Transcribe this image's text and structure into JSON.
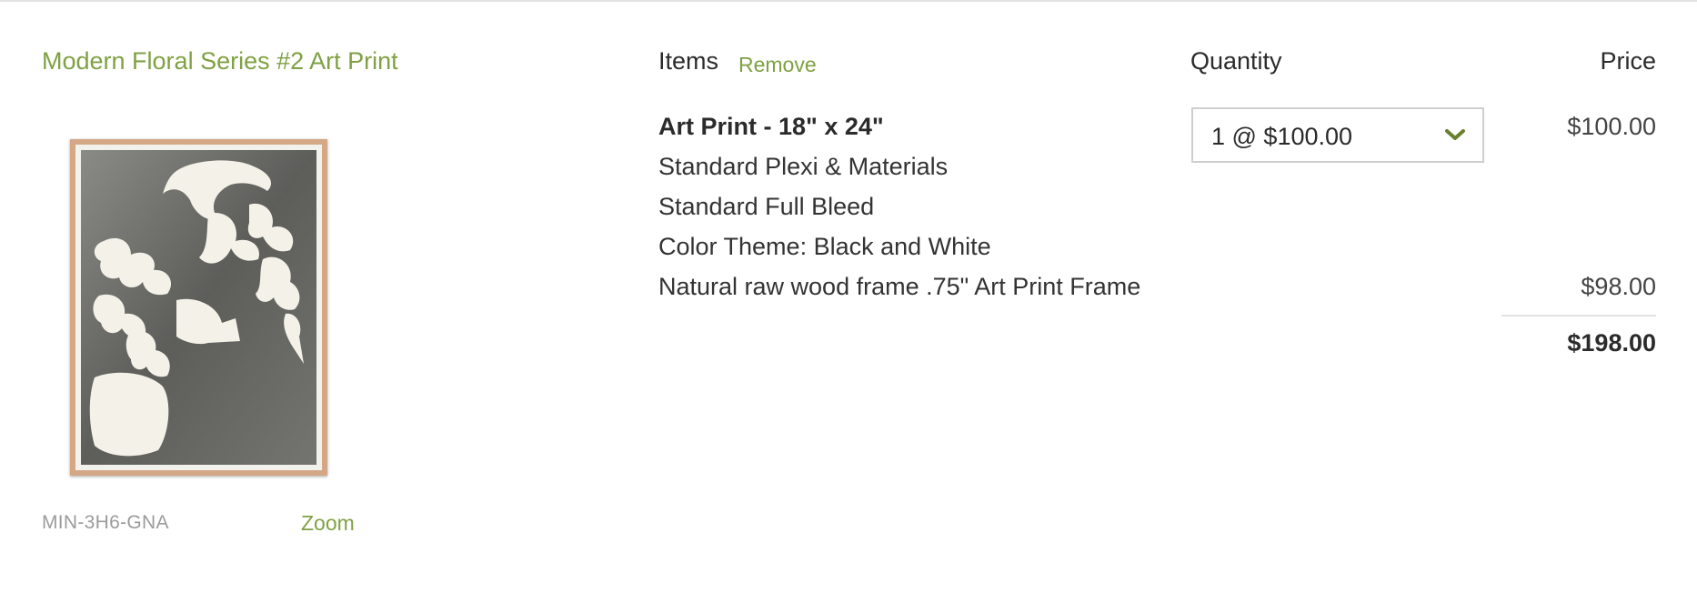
{
  "product": {
    "title": "Modern Floral Series #2 Art Print",
    "sku": "MIN-3H6-GNA",
    "zoom_label": "Zoom",
    "frame_color": "#d4a887"
  },
  "columns": {
    "items": "Items",
    "remove": "Remove",
    "quantity": "Quantity",
    "price": "Price"
  },
  "item": {
    "lines": [
      "Art Print - 18\" x 24\"",
      "Standard Plexi & Materials",
      "Standard Full Bleed",
      "Color Theme: Black and White",
      "Natural raw wood frame .75\" Art Print Frame"
    ]
  },
  "quantity": {
    "selected": "1 @ $100.00",
    "icon": "chevron-down-icon"
  },
  "prices": {
    "print": "$100.00",
    "frame": "$98.00",
    "total": "$198.00"
  },
  "colors": {
    "accent": "#7fa143",
    "text": "#2b2b2b",
    "muted": "#9b9b9b"
  }
}
